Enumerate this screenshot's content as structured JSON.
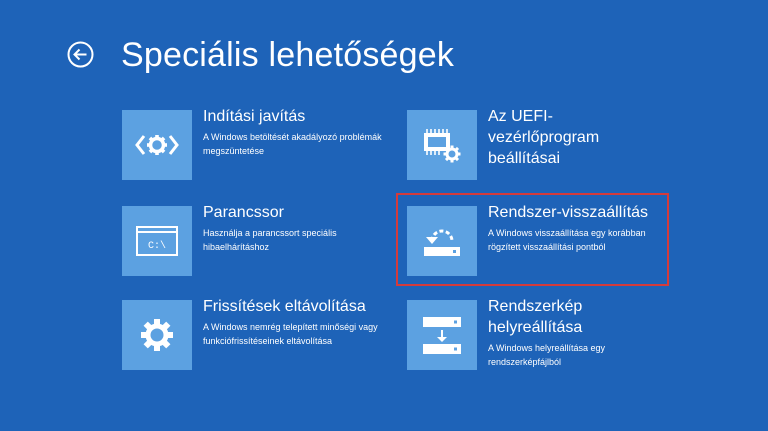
{
  "header": {
    "back_icon": "back-arrow-icon",
    "title": "Speciális lehetőségek"
  },
  "options": [
    {
      "id": "startup-repair",
      "icon": "gear-code-icon",
      "title": "Indítási javítás",
      "description": "A Windows betöltését akadályozó problémák megszüntetése"
    },
    {
      "id": "uefi-settings",
      "icon": "chip-gear-icon",
      "title": "Az UEFI-vezérlőprogram beállításai",
      "description": ""
    },
    {
      "id": "command-prompt",
      "icon": "command-prompt-icon",
      "title": "Parancssor",
      "description": "Használja a parancssort speciális hibaelhárításhoz"
    },
    {
      "id": "system-restore",
      "icon": "system-restore-icon",
      "title": "Rendszer-visszaállítás",
      "description": "A Windows visszaállítása egy korábban rögzített visszaállítási pontból",
      "selected": true
    },
    {
      "id": "uninstall-updates",
      "icon": "gear-icon",
      "title": "Frissítések eltávolítása",
      "description": "A Windows nemrég telepített minőségi vagy funkciófrissítéseinek eltávolítása"
    },
    {
      "id": "system-image-recovery",
      "icon": "system-image-icon",
      "title": "Rendszerkép helyreállítása",
      "description": "A Windows helyreállítása egy rendszerképfájlból"
    }
  ],
  "colors": {
    "background": "#1e63b8",
    "tile": "#5ca1e1",
    "selection_border": "#d43b3b",
    "text": "#ffffff"
  }
}
